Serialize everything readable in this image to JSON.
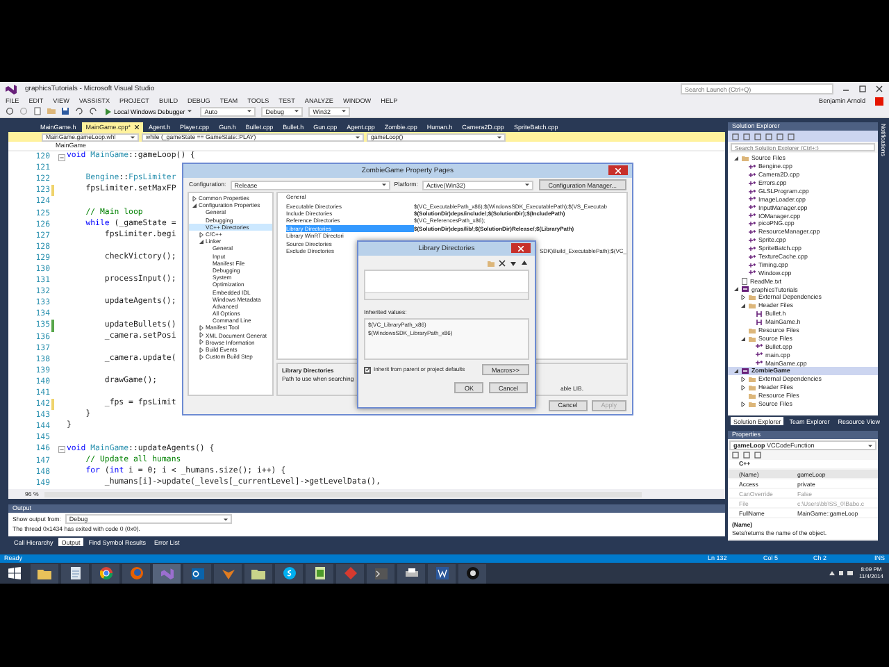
{
  "window": {
    "title": "graphicsTutorials - Microsoft Visual Studio",
    "search_placeholder": "Search Launch (Ctrl+Q)",
    "user": "Benjamin Arnold"
  },
  "menu": [
    "FILE",
    "EDIT",
    "VIEW",
    "VASSISTX",
    "PROJECT",
    "BUILD",
    "DEBUG",
    "TEAM",
    "TOOLS",
    "TEST",
    "ANALYZE",
    "WINDOW",
    "HELP"
  ],
  "toolbar": {
    "run": "Local Windows Debugger",
    "run_combo": "Auto",
    "config": "Debug",
    "platform": "Win32"
  },
  "doc_tabs": [
    {
      "label": "MainGame.h",
      "selected": false
    },
    {
      "label": "MainGame.cpp*",
      "selected": true
    },
    {
      "label": "Agent.h",
      "selected": false
    },
    {
      "label": "Player.cpp",
      "selected": false
    },
    {
      "label": "Gun.h",
      "selected": false
    },
    {
      "label": "Bullet.cpp",
      "selected": false
    },
    {
      "label": "Bullet.h",
      "selected": false
    },
    {
      "label": "Gun.cpp",
      "selected": false
    },
    {
      "label": "Agent.cpp",
      "selected": false
    },
    {
      "label": "Zombie.cpp",
      "selected": false
    },
    {
      "label": "Human.h",
      "selected": false
    },
    {
      "label": "Camera2D.cpp",
      "selected": false
    },
    {
      "label": "SpriteBatch.cpp",
      "selected": false
    }
  ],
  "nav": {
    "file_scope": "MainGame.gameLoop.whl",
    "scope": "while (_gameState == GameState::PLAY)",
    "member": "gameLoop()",
    "breadcrumb": "MainGame"
  },
  "code": [
    {
      "no": "120",
      "fold": true,
      "changed": false,
      "parts": [
        {
          "kind": "kw",
          "text": "void "
        },
        {
          "kind": "type",
          "text": "MainGame"
        },
        {
          "kind": "plain",
          "text": "::gameLoop() {"
        }
      ]
    },
    {
      "no": "121",
      "fold": false,
      "changed": false
    },
    {
      "no": "122",
      "fold": false,
      "changed": false,
      "parts": [
        {
          "kind": "type",
          "text": "    Bengine"
        },
        {
          "kind": "plain",
          "text": "::"
        },
        {
          "kind": "type",
          "text": "FpsLimiter"
        }
      ]
    },
    {
      "no": "123",
      "fold": false,
      "changed": true,
      "saved": false,
      "parts": [
        {
          "kind": "plain",
          "text": "    fpsLimiter.setMaxFP"
        }
      ]
    },
    {
      "no": "124",
      "fold": false,
      "changed": false
    },
    {
      "no": "125",
      "fold": false,
      "changed": false,
      "parts": [
        {
          "kind": "comment",
          "text": "    // Main loop"
        }
      ]
    },
    {
      "no": "126",
      "fold": false,
      "changed": false,
      "parts": [
        {
          "kind": "kw",
          "text": "    while"
        },
        {
          "kind": "plain",
          "text": " (_gameState ="
        }
      ]
    },
    {
      "no": "127",
      "fold": false,
      "changed": false,
      "parts": [
        {
          "kind": "plain",
          "text": "        fpsLimiter.begi"
        }
      ]
    },
    {
      "no": "128",
      "fold": false,
      "changed": false
    },
    {
      "no": "129",
      "fold": false,
      "changed": false,
      "parts": [
        {
          "kind": "plain",
          "text": "        checkVictory();"
        }
      ]
    },
    {
      "no": "130",
      "fold": false,
      "changed": false
    },
    {
      "no": "131",
      "fold": false,
      "changed": false,
      "parts": [
        {
          "kind": "plain",
          "text": "        processInput();"
        }
      ]
    },
    {
      "no": "132",
      "fold": false,
      "changed": false
    },
    {
      "no": "133",
      "fold": false,
      "changed": false,
      "parts": [
        {
          "kind": "plain",
          "text": "        updateAgents();"
        }
      ]
    },
    {
      "no": "134",
      "fold": false,
      "changed": false
    },
    {
      "no": "135",
      "fold": false,
      "changed": true,
      "saved": true,
      "parts": [
        {
          "kind": "plain",
          "text": "        updateBullets()"
        }
      ]
    },
    {
      "no": "136",
      "fold": false,
      "changed": false,
      "parts": [
        {
          "kind": "plain",
          "text": "        _camera.setPosi"
        }
      ]
    },
    {
      "no": "137",
      "fold": false,
      "changed": false
    },
    {
      "no": "138",
      "fold": false,
      "changed": false,
      "parts": [
        {
          "kind": "plain",
          "text": "        _camera.update("
        }
      ]
    },
    {
      "no": "139",
      "fold": false,
      "changed": false
    },
    {
      "no": "140",
      "fold": false,
      "changed": false,
      "parts": [
        {
          "kind": "plain",
          "text": "        drawGame();"
        }
      ]
    },
    {
      "no": "141",
      "fold": false,
      "changed": false
    },
    {
      "no": "142",
      "fold": false,
      "changed": true,
      "saved": false,
      "parts": [
        {
          "kind": "plain",
          "text": "        _fps = fpsLimit"
        }
      ]
    },
    {
      "no": "143",
      "fold": false,
      "changed": false,
      "parts": [
        {
          "kind": "plain",
          "text": "    }"
        }
      ]
    },
    {
      "no": "144",
      "fold": false,
      "changed": false,
      "parts": [
        {
          "kind": "plain",
          "text": "}"
        }
      ]
    },
    {
      "no": "145",
      "fold": false,
      "changed": false
    },
    {
      "no": "146",
      "fold": true,
      "changed": false,
      "parts": [
        {
          "kind": "kw",
          "text": "void "
        },
        {
          "kind": "type",
          "text": "MainGame"
        },
        {
          "kind": "plain",
          "text": "::updateAgents() {"
        }
      ]
    },
    {
      "no": "147",
      "fold": false,
      "changed": false,
      "parts": [
        {
          "kind": "comment",
          "text": "    // Update all humans"
        }
      ]
    },
    {
      "no": "148",
      "fold": false,
      "changed": false,
      "parts": [
        {
          "kind": "kw",
          "text": "    for"
        },
        {
          "kind": "plain",
          "text": " ("
        },
        {
          "kind": "kw",
          "text": "int"
        },
        {
          "kind": "plain",
          "text": " i = 0; i < _humans.size(); i++) {"
        }
      ]
    },
    {
      "no": "149",
      "fold": false,
      "changed": false,
      "parts": [
        {
          "kind": "plain",
          "text": "        _humans[i]->update(_levels[_currentLevel]->getLevelData(),"
        }
      ]
    }
  ],
  "zoom": "96 %",
  "property_pages": {
    "title": "ZombieGame Property Pages",
    "configuration_label": "Configuration:",
    "configuration": "Release",
    "platform_label": "Platform:",
    "platform": "Active(Win32)",
    "manager_button": "Configuration Manager...",
    "tree": [
      {
        "label": "Common Properties",
        "expanded": false,
        "selected": false
      },
      {
        "label": "Configuration Properties",
        "expanded": true,
        "selected": false,
        "children": [
          {
            "label": "General",
            "selected": false
          },
          {
            "label": "Debugging",
            "selected": false
          },
          {
            "label": "VC++ Directories",
            "selected": true
          },
          {
            "label": "C/C++",
            "expanded": false,
            "selected": false
          },
          {
            "label": "Linker",
            "expanded": true,
            "selected": false,
            "children": [
              {
                "label": "General",
                "selected": false
              },
              {
                "label": "Input",
                "selected": false
              },
              {
                "label": "Manifest File",
                "selected": false
              },
              {
                "label": "Debugging",
                "selected": false
              },
              {
                "label": "System",
                "selected": false
              },
              {
                "label": "Optimization",
                "selected": false
              },
              {
                "label": "Embedded IDL",
                "selected": false
              },
              {
                "label": "Windows Metadata",
                "selected": false
              },
              {
                "label": "Advanced",
                "selected": false
              },
              {
                "label": "All Options",
                "selected": false
              },
              {
                "label": "Command Line",
                "selected": false
              }
            ]
          },
          {
            "label": "Manifest Tool",
            "expanded": false,
            "selected": false
          },
          {
            "label": "XML Document Generat",
            "expanded": false,
            "selected": false
          },
          {
            "label": "Browse Information",
            "expanded": false,
            "selected": false
          },
          {
            "label": "Build Events",
            "expanded": false,
            "selected": false
          },
          {
            "label": "Custom Build Step",
            "expanded": false,
            "selected": false
          }
        ]
      }
    ],
    "section": "General",
    "rows": [
      {
        "label": "Executable Directories",
        "value": "$(VC_ExecutablePath_x86);$(WindowsSDK_ExecutablePath);$(VS_Executab",
        "bold": false,
        "selected": false
      },
      {
        "label": "Include Directories",
        "value": "$(SolutionDir)deps/include/;$(SolutionDir);$(IncludePath)",
        "bold": true,
        "selected": false
      },
      {
        "label": "Reference Directories",
        "value": "$(VC_ReferencesPath_x86);",
        "bold": false,
        "selected": false
      },
      {
        "label": "Library Directories",
        "value": "$(SolutionDir)deps/lib/;$(SolutionDir)Release/;$(LibraryPath)",
        "bold": true,
        "selected": true
      },
      {
        "label": "Library WinRT Directori",
        "selected": false
      },
      {
        "label": "Source Directories",
        "selected": false
      },
      {
        "label": "Exclude Directories",
        "value": "SDK)Build_ExecutablePath);$(VC_",
        "bold": false,
        "selected": false,
        "clipped": true
      }
    ],
    "description_title": "Library Directories",
    "description": "Path to use when searching",
    "description_tail": "able LIB.",
    "buttons": [
      {
        "label": "Cancel",
        "disabled": false
      },
      {
        "label": "Apply",
        "disabled": true
      }
    ]
  },
  "library_dialog": {
    "title": "Library Directories",
    "inherited_label": "Inherited values:",
    "inherited": [
      "$(VC_LibraryPath_x86)",
      "$(WindowsSDK_LibraryPath_x86)"
    ],
    "inherit_checkbox": {
      "label": "Inherit from parent or project defaults",
      "checked": true
    },
    "macros_button": "Macros>>",
    "ok": "OK",
    "cancel": "Cancel"
  },
  "solution_explorer": {
    "title": "Solution Explorer",
    "search_placeholder": "Search Solution Explorer (Ctrl+;)",
    "tree": [
      {
        "label": "Source Files",
        "kind": "folder",
        "expanded": true,
        "selected": false,
        "children": [
          {
            "label": "Bengine.cpp",
            "kind": "cpp"
          },
          {
            "label": "Camera2D.cpp",
            "kind": "cpp"
          },
          {
            "label": "Errors.cpp",
            "kind": "cpp"
          },
          {
            "label": "GLSLProgram.cpp",
            "kind": "cpp"
          },
          {
            "label": "ImageLoader.cpp",
            "kind": "cpp"
          },
          {
            "label": "InputManager.cpp",
            "kind": "cpp"
          },
          {
            "label": "IOManager.cpp",
            "kind": "cpp"
          },
          {
            "label": "picoPNG.cpp",
            "kind": "cpp"
          },
          {
            "label": "ResourceManager.cpp",
            "kind": "cpp"
          },
          {
            "label": "Sprite.cpp",
            "kind": "cpp"
          },
          {
            "label": "SpriteBatch.cpp",
            "kind": "cpp"
          },
          {
            "label": "TextureCache.cpp",
            "kind": "cpp"
          },
          {
            "label": "Timing.cpp",
            "kind": "cpp"
          },
          {
            "label": "Window.cpp",
            "kind": "cpp"
          }
        ]
      },
      {
        "label": "ReadMe.txt",
        "kind": "txt"
      },
      {
        "label": "graphicsTutorials",
        "kind": "project",
        "expanded": true,
        "selected": false,
        "children": [
          {
            "label": "External Dependencies",
            "kind": "folder",
            "expanded": false
          },
          {
            "label": "Header Files",
            "kind": "folder",
            "expanded": true,
            "children": [
              {
                "label": "Bullet.h",
                "kind": "h"
              },
              {
                "label": "MainGame.h",
                "kind": "h"
              }
            ]
          },
          {
            "label": "Resource Files",
            "kind": "folder"
          },
          {
            "label": "Source Files",
            "kind": "folder",
            "expanded": true,
            "children": [
              {
                "label": "Bullet.cpp",
                "kind": "cpp"
              },
              {
                "label": "main.cpp",
                "kind": "cpp"
              },
              {
                "label": "MainGame.cpp",
                "kind": "cpp"
              }
            ]
          }
        ]
      },
      {
        "label": "ZombieGame",
        "kind": "project",
        "expanded": true,
        "selected": true,
        "children": [
          {
            "label": "External Dependencies",
            "kind": "folder",
            "expanded": false
          },
          {
            "label": "Header Files",
            "kind": "folder",
            "expanded": false
          },
          {
            "label": "Resource Files",
            "kind": "folder"
          },
          {
            "label": "Source Files",
            "kind": "folder",
            "expanded": false
          }
        ]
      }
    ],
    "tabs": [
      {
        "label": "Solution Explorer",
        "selected": true
      },
      {
        "label": "Team Explorer",
        "selected": false
      },
      {
        "label": "Resource View",
        "selected": false
      }
    ]
  },
  "properties": {
    "title": "Properties",
    "object": "gameLoop",
    "object_type": "VCCodeFunction",
    "category": "C++",
    "rows": [
      {
        "name": "(Name)",
        "value": "gameLoop",
        "selected": true,
        "disabled": false
      },
      {
        "name": "Access",
        "value": "private",
        "selected": false,
        "disabled": false
      },
      {
        "name": "CanOverride",
        "value": "False",
        "selected": false,
        "disabled": true
      },
      {
        "name": "File",
        "value": "c:\\Users\\bb\\SS_0\\Babo.c",
        "selected": false,
        "disabled": true
      },
      {
        "name": "FullName",
        "value": "MainGame::gameLoop",
        "selected": false,
        "disabled": false
      }
    ],
    "description_title": "(Name)",
    "description": "Sets/returns the name of the object."
  },
  "output": {
    "title": "Output",
    "show_label": "Show output from:",
    "source": "Debug",
    "lines": [
      "The thread 0x1434 has exited with code 0 (0x0)."
    ],
    "tabs": [
      {
        "label": "Call Hierarchy",
        "selected": false
      },
      {
        "label": "Output",
        "selected": true
      },
      {
        "label": "Find Symbol Results",
        "selected": false
      },
      {
        "label": "Error List",
        "selected": false
      }
    ]
  },
  "side_tab": "Notifications",
  "status_bar": {
    "message": "Ready",
    "line": "Ln 132",
    "col": "Col 5",
    "ch": "Ch 2",
    "mode": "INS"
  },
  "taskbar": {
    "time": "8:09 PM",
    "date": "11/4/2014"
  }
}
